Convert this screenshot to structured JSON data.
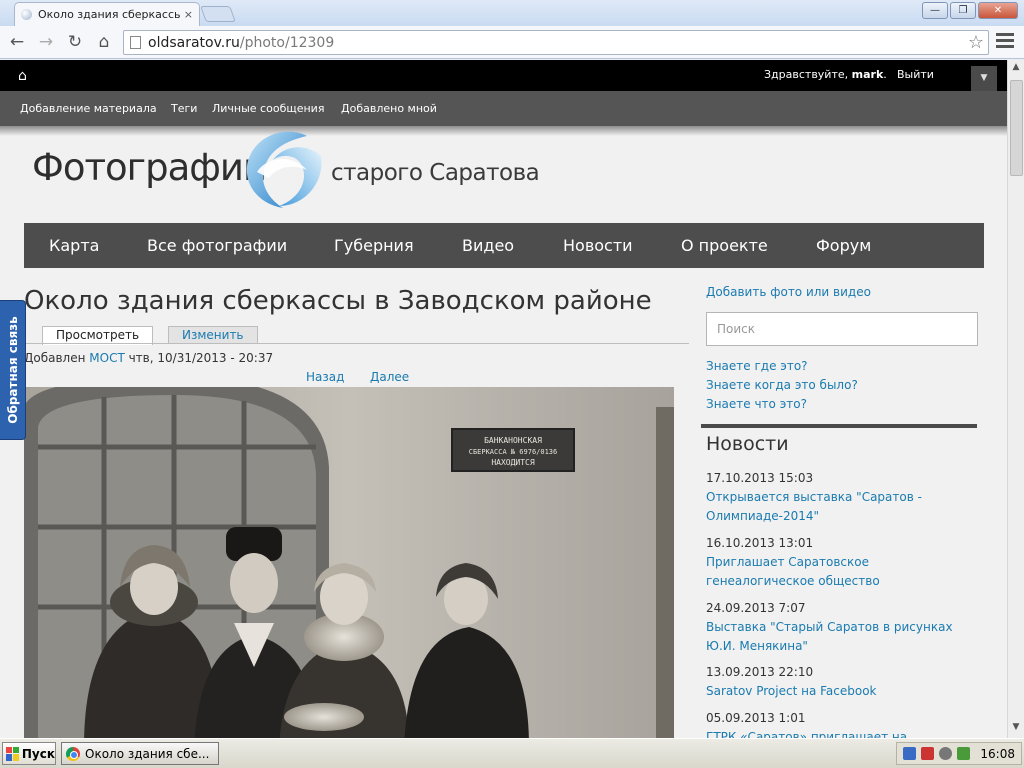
{
  "browser": {
    "tab_title": "Около здания сберкассы в",
    "tab_close": "×",
    "url_host": "oldsaratov.ru",
    "url_path": "/photo/12309",
    "star": "☆",
    "back": "←",
    "forward": "→",
    "reload": "↻",
    "home": "⌂",
    "win_minimize": "—",
    "win_restore": "❐",
    "win_close": "✕"
  },
  "site_top": {
    "home": "⌂",
    "greeting_prefix": "Здравствуйте, ",
    "greeting_user": "mark",
    "greeting_suffix": ".",
    "logout": "Выйти",
    "menu_toggle": "▼"
  },
  "admin_menu": [
    "Добавление материала",
    "Теги",
    "Личные сообщения",
    "Добавлено мной"
  ],
  "logo": {
    "left": "Фотографии",
    "right": "старого Саратова"
  },
  "main_nav": [
    "Карта",
    "Все фотографии",
    "Губерния",
    "Видео",
    "Новости",
    "О проекте",
    "Форум"
  ],
  "page": {
    "title": "Около здания сберкассы в Заводском районе",
    "tab_view": "Просмотреть",
    "tab_edit": "Изменить",
    "added_prefix": "Добавлен ",
    "added_author": "МОСТ",
    "added_date": " чтв, 10/31/2013 - 20:37",
    "prev": "Назад",
    "next": "Далее",
    "plaque_line1": "БАНКАНОНСКАЯ",
    "plaque_line2": "СБЕРКАССА № 6976/0136",
    "plaque_line3": "НАХОДИТСЯ"
  },
  "sidebar": {
    "add_photo": "Добавить фото или видео",
    "search_placeholder": "Поиск",
    "links": [
      "Знаете где это?",
      "Знаете когда это было?",
      "Знаете что это?"
    ],
    "news_title": "Новости",
    "news": [
      {
        "date": "17.10.2013 15:03",
        "title": "Открывается выставка \"Саратов - Олимпиаде-2014\""
      },
      {
        "date": "16.10.2013 13:01",
        "title": "Приглашает Саратовское генеалогическое общество"
      },
      {
        "date": "24.09.2013 7:07",
        "title": "Выставка \"Старый Саратов в рисунках Ю.И. Менякина\""
      },
      {
        "date": "13.09.2013 22:10",
        "title": "Saratov Project на Facebook"
      },
      {
        "date": "05.09.2013 1:01",
        "title": "ГТРК «Саратов» приглашает на"
      }
    ]
  },
  "feedback": "Обратная связь",
  "taskbar": {
    "start": "Пуск",
    "task": "Около здания сбе...",
    "clock": "16:08"
  },
  "colors": {
    "link": "#1a7bb0",
    "nav_bg": "#4d4d4d",
    "admin_bg": "#555555",
    "feedback_bg": "#2d62ae"
  }
}
